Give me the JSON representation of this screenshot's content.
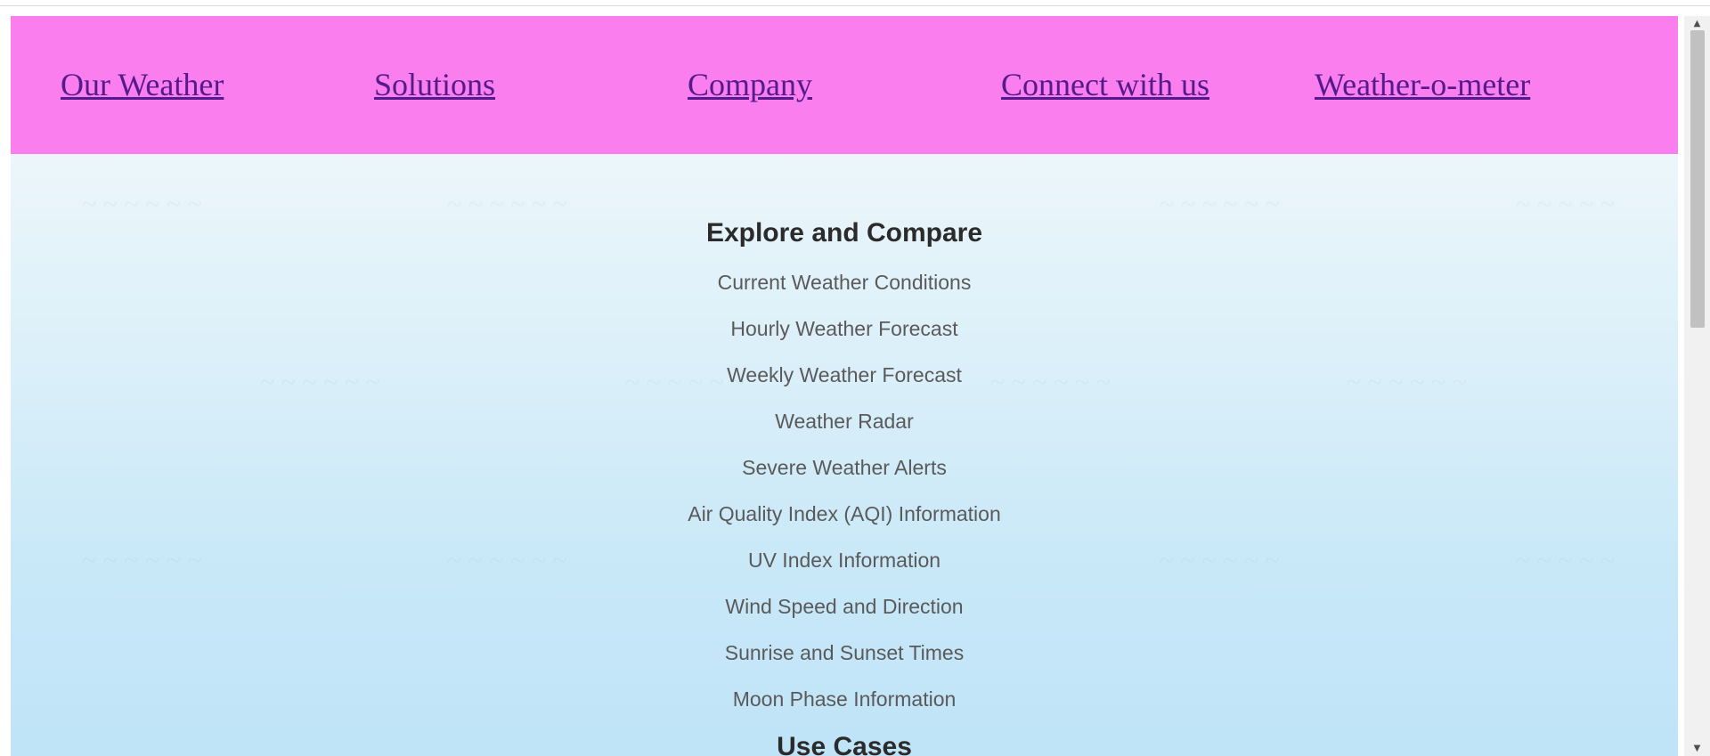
{
  "nav": {
    "items": [
      {
        "label": "Our Weather"
      },
      {
        "label": "Solutions"
      },
      {
        "label": "Company"
      },
      {
        "label": "Connect with us"
      },
      {
        "label": "Weather-o-meter"
      }
    ]
  },
  "colors": {
    "navbar_bg": "#fb7eee",
    "link": "#551a8b",
    "heading": "#2b2b2b",
    "item_text": "#5a5a5a"
  },
  "sections": [
    {
      "title": "Explore and Compare",
      "items": [
        "Current Weather Conditions",
        "Hourly Weather Forecast",
        "Weekly Weather Forecast",
        "Weather Radar",
        "Severe Weather Alerts",
        "Air Quality Index (AQI) Information",
        "UV Index Information",
        "Wind Speed and Direction",
        "Sunrise and Sunset Times",
        "Moon Phase Information"
      ]
    },
    {
      "title": "Use Cases",
      "items": []
    }
  ]
}
